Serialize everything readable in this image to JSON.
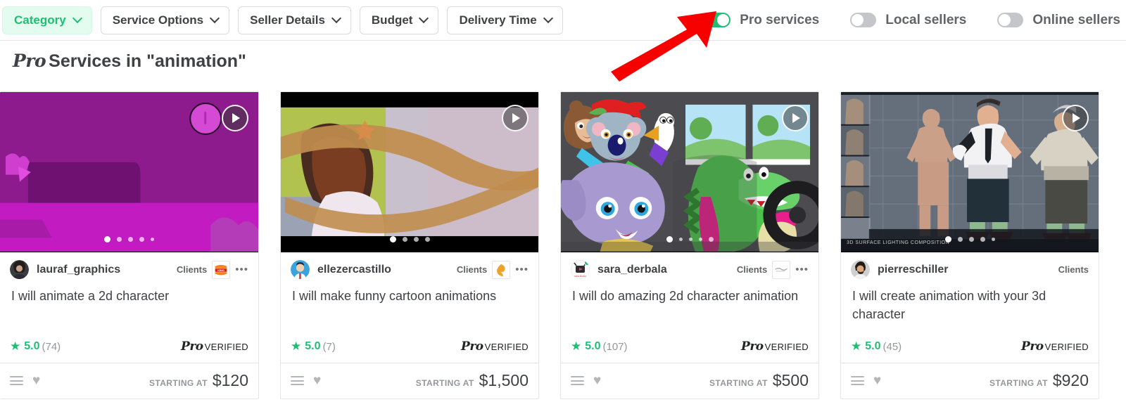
{
  "filters": {
    "buttons": [
      {
        "label": "Category",
        "active": true
      },
      {
        "label": "Service Options",
        "active": false
      },
      {
        "label": "Seller Details",
        "active": false
      },
      {
        "label": "Budget",
        "active": false
      },
      {
        "label": "Delivery Time",
        "active": false
      }
    ],
    "toggles": [
      {
        "label": "Pro services",
        "on": true
      },
      {
        "label": "Local sellers",
        "on": false
      },
      {
        "label": "Online sellers",
        "on": false
      }
    ]
  },
  "heading": {
    "pro": "Pro",
    "text": "Services in \"animation\""
  },
  "labels": {
    "clients": "Clients",
    "verified_pro": "Pro",
    "verified_text": "VERIFIED",
    "starting_at": "STARTING AT",
    "more_options": "•••"
  },
  "colors": {
    "brand_green": "#1dbf73",
    "category_bg": "#e4fbf0",
    "text_dark": "#404145",
    "text_muted": "#95979d",
    "arrow_red": "#f60000"
  },
  "cards": [
    {
      "seller": "lauraf_graphics",
      "title": "I will animate a 2d character",
      "rating": "5.0",
      "reviews": "(74)",
      "price": "$120",
      "dots_total": 5,
      "dots_active": 0,
      "client_logo": "burger-king-logo",
      "online": false,
      "thumb_caption": ""
    },
    {
      "seller": "ellezercastillo",
      "title": "I will make funny cartoon animations",
      "rating": "5.0",
      "reviews": "(7)",
      "price": "$1,500",
      "dots_total": 4,
      "dots_active": 0,
      "client_logo": "adobe-logo",
      "online": false,
      "thumb_caption": ""
    },
    {
      "seller": "sara_derbala",
      "title": "I will do amazing 2d character animation",
      "rating": "5.0",
      "reviews": "(107)",
      "price": "$500",
      "dots_total": 5,
      "dots_active": 0,
      "client_logo": "blank-logo",
      "online": true,
      "thumb_caption": ""
    },
    {
      "seller": "pierreschiller",
      "title": "I will create animation with your 3d character",
      "rating": "5.0",
      "reviews": "(45)",
      "price": "$920",
      "dots_total": 5,
      "dots_active": 0,
      "client_logo": "",
      "online": false,
      "thumb_caption": "3D SURFACE LIGHTING COMPOSITION"
    }
  ]
}
